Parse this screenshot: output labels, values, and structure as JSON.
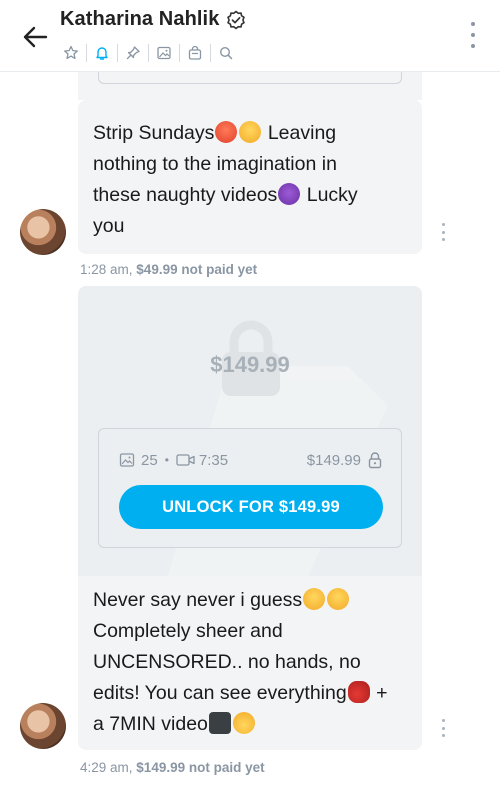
{
  "header": {
    "title": "Katharina Nahlik",
    "icons": [
      "back-arrow-icon",
      "verified-icon",
      "star-icon",
      "bell-icon",
      "pin-icon",
      "image-icon",
      "bag-icon",
      "search-icon",
      "more-vertical-icon"
    ],
    "accent_color": "#00aff0"
  },
  "messages": [
    {
      "text_lines": [
        "Strip Sundays",
        "Leaving",
        "nothing to the imagination in",
        "these naughty videos",
        "Lucky",
        "you"
      ],
      "time": "1:28 am,",
      "price_status": "$49.99 not paid yet"
    },
    {
      "locked_media": {
        "price_overlay": "$149.99",
        "image_count": "25",
        "video_length": "7:35",
        "price": "$149.99",
        "unlock_label": "UNLOCK FOR $149.99"
      },
      "text_lines": [
        "Never say never i guess",
        "Completely sheer and",
        "UNCENSORED.. no hands, no",
        "edits! You can see everything",
        "+",
        "a 7MIN video"
      ],
      "time": "4:29 am,",
      "price_status": "$149.99 not paid yet"
    }
  ]
}
